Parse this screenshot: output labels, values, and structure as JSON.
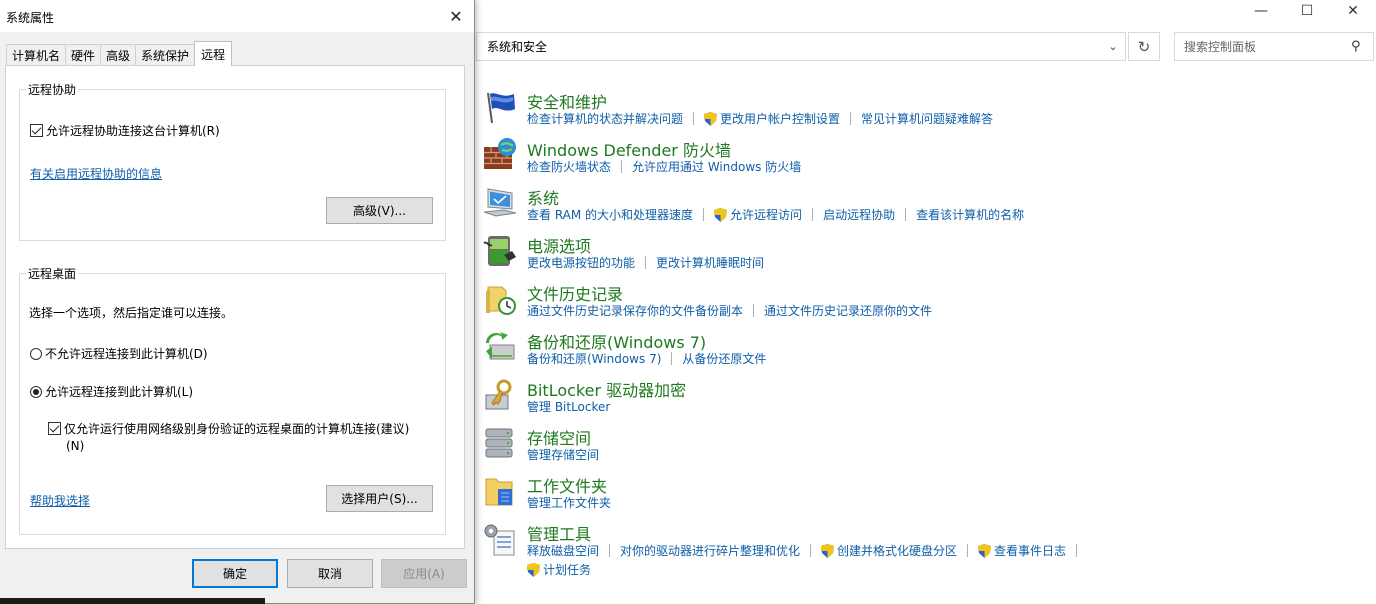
{
  "control_panel": {
    "address": "系统和安全",
    "search_placeholder": "搜索控制面板",
    "categories": [
      {
        "title": "安全和维护",
        "links": [
          "检查计算机的状态并解决问题",
          "更改用户帐户控制设置",
          "常见计算机问题疑难解答"
        ]
      },
      {
        "title": "Windows Defender 防火墙",
        "links": [
          "检查防火墙状态",
          "允许应用通过 Windows 防火墙"
        ]
      },
      {
        "title": "系统",
        "links": [
          "查看 RAM 的大小和处理器速度",
          "允许远程访问",
          "启动远程协助",
          "查看该计算机的名称"
        ]
      },
      {
        "title": "电源选项",
        "links": [
          "更改电源按钮的功能",
          "更改计算机睡眠时间"
        ]
      },
      {
        "title": "文件历史记录",
        "links": [
          "通过文件历史记录保存你的文件备份副本",
          "通过文件历史记录还原你的文件"
        ]
      },
      {
        "title": "备份和还原(Windows 7)",
        "links": [
          "备份和还原(Windows 7)",
          "从备份还原文件"
        ]
      },
      {
        "title": "BitLocker 驱动器加密",
        "links": [
          "管理 BitLocker"
        ]
      },
      {
        "title": "存储空间",
        "links": [
          "管理存储空间"
        ]
      },
      {
        "title": "工作文件夹",
        "links": [
          "管理工作文件夹"
        ]
      },
      {
        "title": "管理工具",
        "links": [
          "释放磁盘空间",
          "对你的驱动器进行碎片整理和优化",
          "创建并格式化硬盘分区",
          "查看事件日志",
          "计划任务"
        ]
      }
    ]
  },
  "dialog": {
    "title": "系统属性",
    "tabs": [
      "计算机名",
      "硬件",
      "高级",
      "系统保护",
      "远程"
    ],
    "remote_assistance": {
      "group_label": "远程协助",
      "allow_checkbox": "允许远程协助连接这台计算机(R)",
      "info_link": "有关启用远程协助的信息",
      "advanced_button": "高级(V)..."
    },
    "remote_desktop": {
      "group_label": "远程桌面",
      "instruction": "选择一个选项，然后指定谁可以连接。",
      "option_deny": "不允许远程连接到此计算机(D)",
      "option_allow": "允许远程连接到此计算机(L)",
      "nla_checkbox_line1": "仅允许运行使用网络级别身份验证的远程桌面的计算机连接(建议)",
      "nla_checkbox_line2": "(N)",
      "help_link": "帮助我选择",
      "select_users_button": "选择用户(S)..."
    },
    "buttons": {
      "ok": "确定",
      "cancel": "取消",
      "apply": "应用(A)"
    }
  }
}
